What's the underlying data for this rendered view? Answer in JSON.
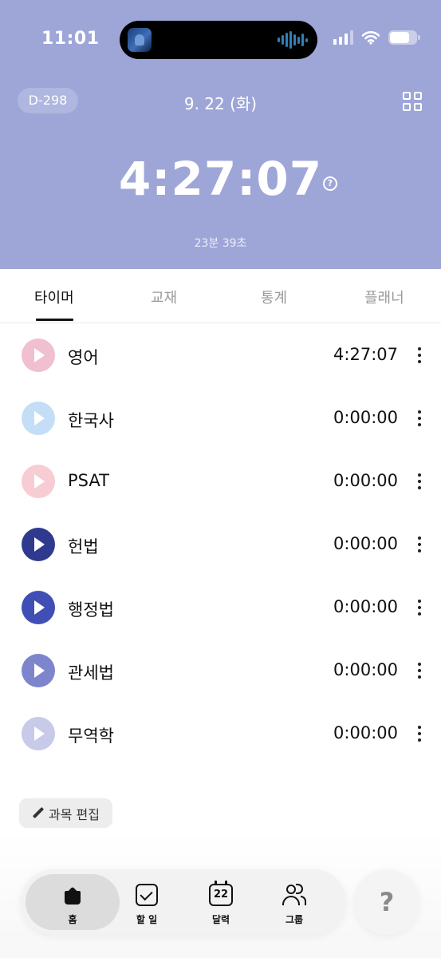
{
  "status_bar": {
    "time": "11:01",
    "island_art_icon": "album-art-icon",
    "audio_icon": "waveform-icon",
    "signal_icon": "cellular-signal-icon",
    "wifi_icon": "wifi-icon",
    "battery_icon": "battery-icon"
  },
  "header": {
    "dday": "D-298",
    "date": "9. 22 (화)",
    "menu_icon": "grid-icon",
    "total_time": "4:27:07",
    "help_icon": "question-circle-icon",
    "sub_time": "23분 39초",
    "background_color": "#9ea6d8"
  },
  "tabs": [
    {
      "label": "타이머",
      "active": true
    },
    {
      "label": "교재",
      "active": false
    },
    {
      "label": "통계",
      "active": false
    },
    {
      "label": "플래너",
      "active": false
    }
  ],
  "subjects": [
    {
      "name": "영어",
      "time": "4:27:07",
      "color": "#f0bfd0"
    },
    {
      "name": "한국사",
      "time": "0:00:00",
      "color": "#c3def6"
    },
    {
      "name": "PSAT",
      "time": "0:00:00",
      "color": "#f7ccd3"
    },
    {
      "name": "헌법",
      "time": "0:00:00",
      "color": "#2f3a8f"
    },
    {
      "name": "행정법",
      "time": "0:00:00",
      "color": "#3f4fb5"
    },
    {
      "name": "관세법",
      "time": "0:00:00",
      "color": "#7d86cc"
    },
    {
      "name": "무역학",
      "time": "0:00:00",
      "color": "#c7cae9"
    }
  ],
  "edit_button": {
    "label": "과목 편집",
    "icon": "pencil-icon"
  },
  "bottom_nav": [
    {
      "label": "홈",
      "icon": "home-icon",
      "active": true
    },
    {
      "label": "할 일",
      "icon": "checkbox-icon",
      "active": false
    },
    {
      "label": "달력",
      "icon": "calendar-icon",
      "day": "22",
      "active": false
    },
    {
      "label": "그룹",
      "icon": "group-icon",
      "active": false
    }
  ],
  "help_button": {
    "label": "?",
    "icon": "question-icon"
  }
}
